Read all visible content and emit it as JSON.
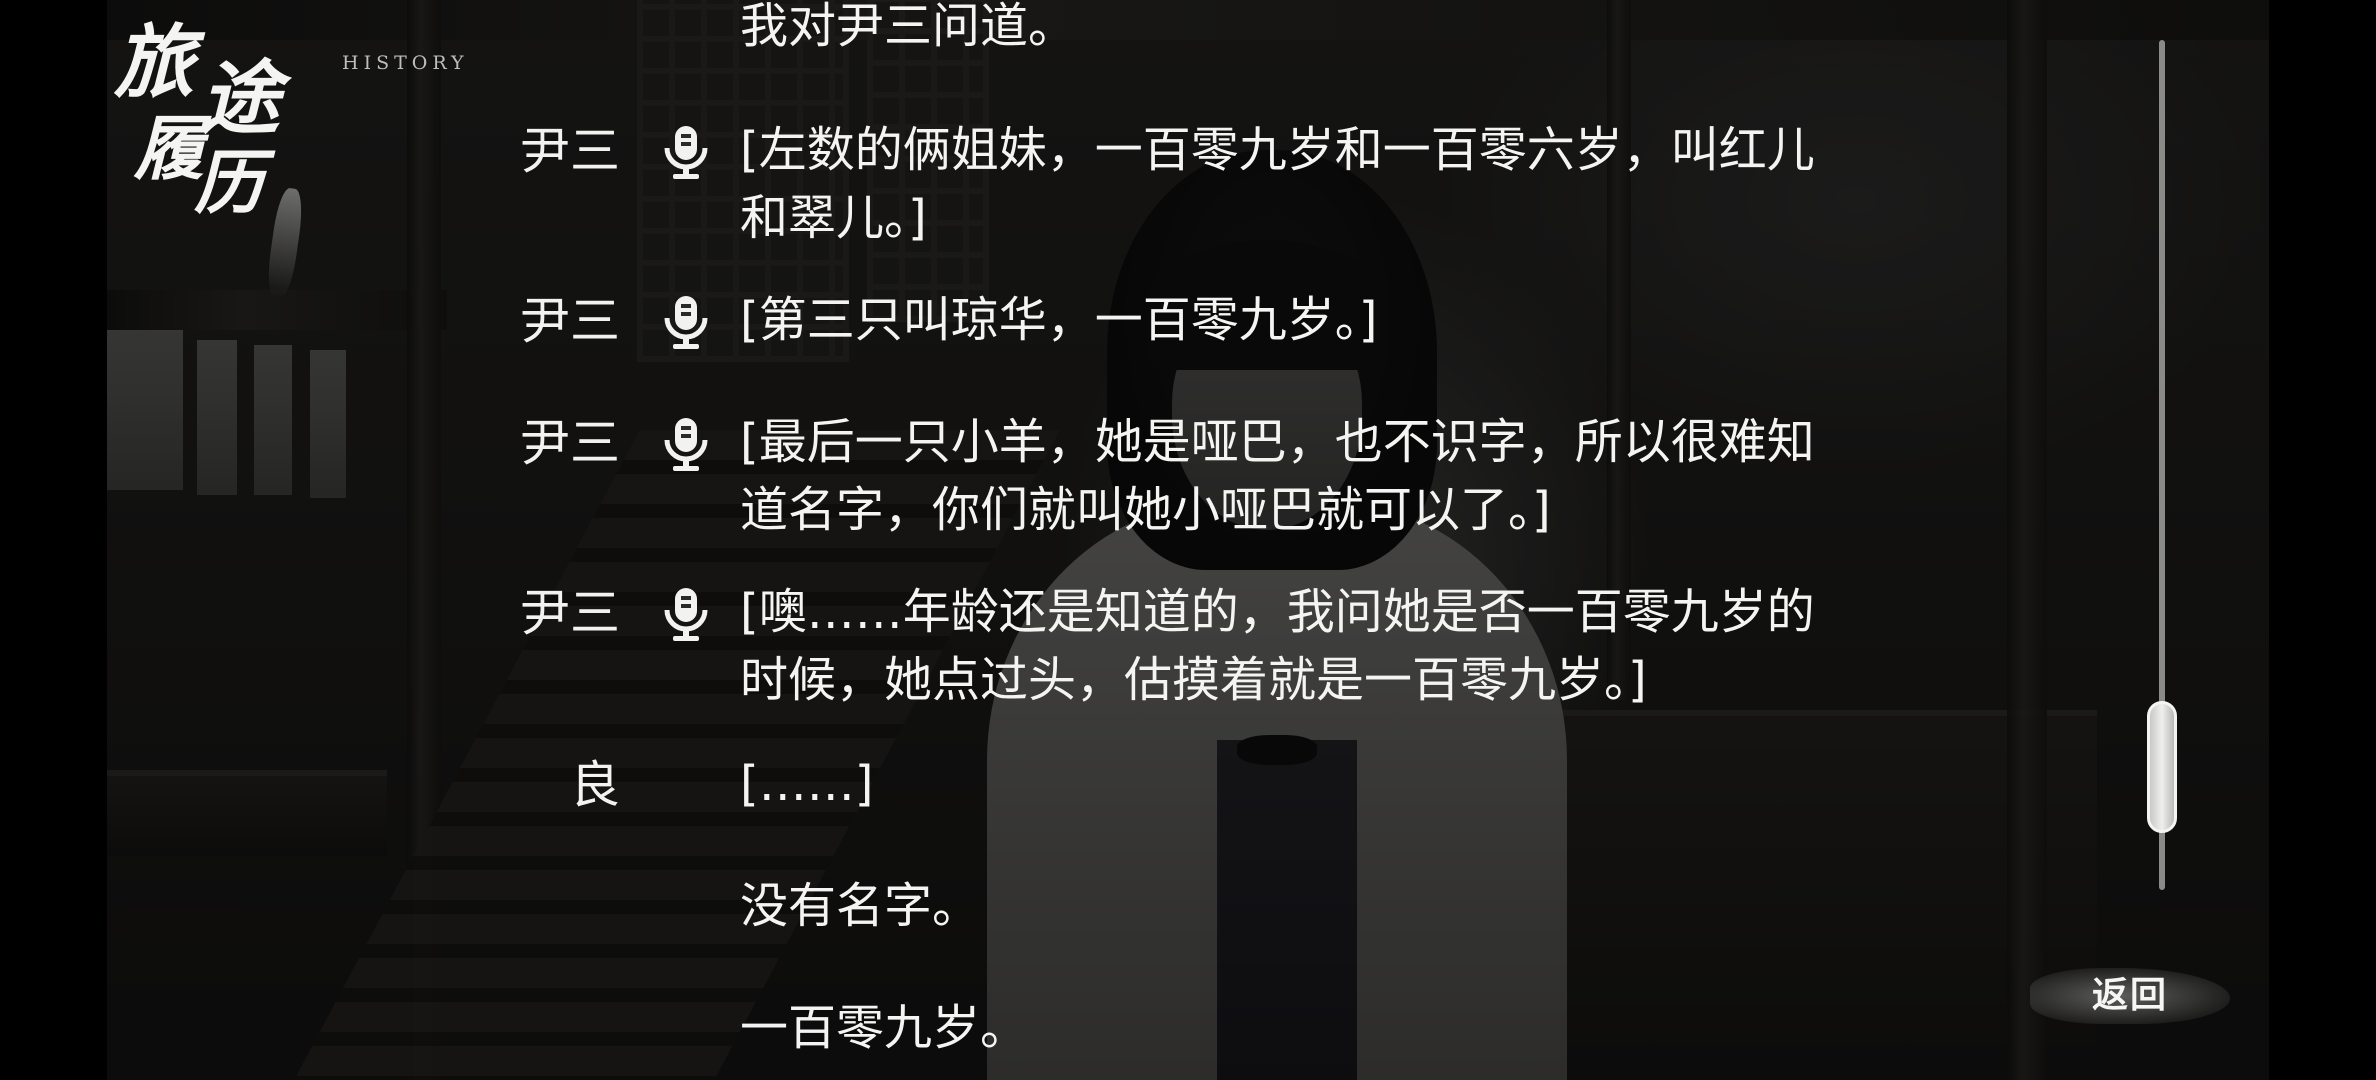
{
  "logo": {
    "title_chars": [
      "旅",
      "途",
      "履",
      "历"
    ],
    "subtitle": "HISTORY"
  },
  "history": [
    {
      "speaker": "",
      "has_voice": false,
      "text": "我对尹三问道。"
    },
    {
      "speaker": "尹三",
      "has_voice": true,
      "text": "[左数的俩姐妹，一百零九岁和一百零六岁，叫红儿\n和翠儿。]"
    },
    {
      "speaker": "尹三",
      "has_voice": true,
      "text": "[第三只叫琼华，一百零九岁。]"
    },
    {
      "speaker": "尹三",
      "has_voice": true,
      "text": "[最后一只小羊，她是哑巴，也不识字，所以很难知\n道名字，你们就叫她小哑巴就可以了。]"
    },
    {
      "speaker": "尹三",
      "has_voice": true,
      "text": "[噢……年龄还是知道的，我问她是否一百零九岁的\n时候，她点过头，估摸着就是一百零九岁。]"
    },
    {
      "speaker": "良",
      "has_voice": false,
      "text": "[……]"
    },
    {
      "speaker": "",
      "has_voice": false,
      "text": "没有名字。"
    },
    {
      "speaker": "",
      "has_voice": false,
      "text": "一百零九岁。"
    }
  ],
  "scrollbar": {
    "position_fraction": 0.92
  },
  "controls": {
    "back_label": "返回"
  },
  "icons": {
    "voice": "microphone-icon"
  }
}
